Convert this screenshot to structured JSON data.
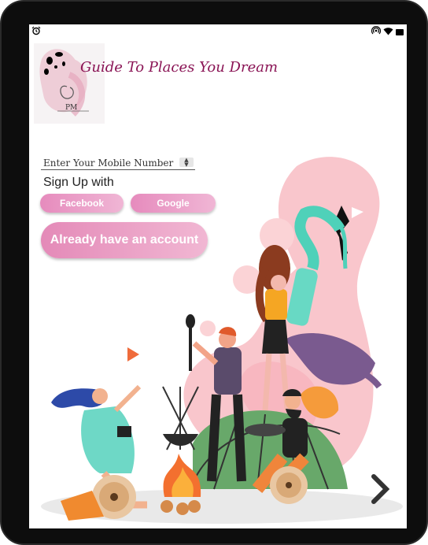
{
  "app": {
    "title": "Guide To Places You Dream"
  },
  "signup": {
    "mobile_placeholder": "Enter Your Mobile Number",
    "signup_with": "Sign Up with",
    "facebook_label": "Facebook",
    "google_label": "Google",
    "existing_account_label": "Already have an account"
  },
  "logo": {
    "text": "PM"
  },
  "colors": {
    "title": "#8a1455",
    "button_start": "#e68bbd",
    "button_end": "#f0b6d5"
  },
  "icons": {
    "status_left": "alarm-icon",
    "status_right": [
      "hotspot-icon",
      "wifi-icon",
      "battery-icon"
    ],
    "next": "chevron-right-icon"
  }
}
